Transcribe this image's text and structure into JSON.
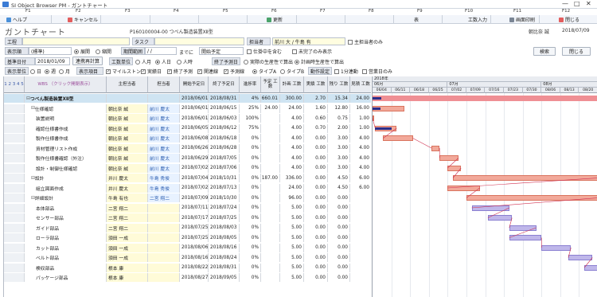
{
  "window": {
    "title": "SI Object Browser PM - ガントチャート",
    "controls": [
      "—",
      "□",
      "✕"
    ]
  },
  "fkeys": [
    "F1",
    "F2",
    "F3",
    "F4",
    "F5",
    "F6",
    "F7",
    "F8",
    "F9",
    "F10",
    "F11",
    "F12"
  ],
  "fbar": {
    "help": "ヘルプ",
    "cancel": "キャンセル",
    "update": "更新",
    "table": "表",
    "work_input": "工数入力",
    "print": "画面印刷",
    "close": "閉じる"
  },
  "heading": "ガントチャート",
  "project_id": "P160100004-00 つべん製造装置XⅡ型",
  "user_label": "朝比奈 誠",
  "date_right": "2018/07/09",
  "filters": {
    "process_label": "工程",
    "task_label": "タスク",
    "person_label": "担当者",
    "person_value": "朝比奈 誠",
    "person_value2": "前川 大 / 牛島 有",
    "only_main": "主担当者のみ",
    "display_label": "表示順",
    "display_value": "(標準)",
    "exp_label": "展開",
    "coll_label": "縮開",
    "period_label": "期間範囲",
    "period_value": "/ /",
    "period_to": "までに",
    "not_started": "開始予定",
    "in_progress": "仕掛中を含む",
    "not_done": "未完了のみ表示",
    "search": "検索",
    "close_btn": "閉じる",
    "date_label": "基準日付",
    "date_value": "2018/01/09",
    "recalc": "連携再計算",
    "unit_label": "工数単位",
    "unit_h": "人月",
    "unit_d": "人日",
    "unit_hr": "人時",
    "end_forecast": "終了予測日",
    "end_opt1": "実際の生産性で算出",
    "end_opt2": "計画時生産性で算出",
    "disp_unit": "表示単位",
    "disp_day": "日",
    "disp_week": "週",
    "disp_month": "月",
    "disp_items": "表示項目",
    "item_milestone": "マイルストン",
    "item_actual": "実績日",
    "item_end": "終了予測",
    "item_related": "関連線",
    "item_forecast": "予測線",
    "type_a": "タイプA",
    "type_b": "タイプB",
    "link_label": "動作設定",
    "item_1": "1分連動",
    "item_holiday": "営業日のみ"
  },
  "columns": {
    "c0": "1 2 3 4 5",
    "c1": "WBS （クリック開閉表示）",
    "c2": "主担当者",
    "c3": "担当者",
    "c4": "開始予定日",
    "c5": "終了予定日",
    "c6": "進捗率",
    "c7": "予定 工数",
    "c8": "計画 工数",
    "c9": "実績 工数",
    "c10": "残り 工数",
    "c11": "見積 工数"
  },
  "rows": [
    {
      "level": 0,
      "name": "つべん製造装置XⅡ型",
      "main": "",
      "pic": "",
      "start": "2018/06/01",
      "end": "2018/08/31",
      "pct": "4%",
      "plan": "660.01",
      "est": "300.00",
      "act": "2.70",
      "rem": "15.34",
      "quote": "24.00",
      "kind": "total"
    },
    {
      "level": 1,
      "name": "仕様確認",
      "main": "朝比奈 誠",
      "pic": "前川 慶太",
      "start": "2018/06/01",
      "end": "2018/06/15",
      "pct": "25%",
      "plan": "24.00",
      "est": "24.00",
      "act": "1.60",
      "rem": "12.80",
      "quote": "16.00",
      "kind": "group"
    },
    {
      "level": 2,
      "name": "装置説明",
      "main": "朝比奈 誠",
      "pic": "前川 慶太",
      "start": "2018/06/01",
      "end": "2018/06/03",
      "pct": "100%",
      "plan": "",
      "est": "4.00",
      "act": "0.60",
      "rem": "0.75",
      "quote": "1.00",
      "kind": "task"
    },
    {
      "level": 2,
      "name": "確認仕様書作成",
      "main": "朝比奈 誠",
      "pic": "前川 慶太",
      "start": "2018/06/05",
      "end": "2018/06/12",
      "pct": "75%",
      "plan": "",
      "est": "4.00",
      "act": "0.70",
      "rem": "2.00",
      "quote": "1.00",
      "kind": "task"
    },
    {
      "level": 2,
      "name": "製作仕様書作成",
      "main": "朝比奈 誠",
      "pic": "前川 慶太",
      "start": "2018/06/08",
      "end": "2018/06/18",
      "pct": "0%",
      "plan": "",
      "est": "4.00",
      "act": "0.00",
      "rem": "3.00",
      "quote": "4.00",
      "kind": "task"
    },
    {
      "level": 2,
      "name": "資材管理リスト作成",
      "main": "朝比奈 誠",
      "pic": "前川 慶太",
      "start": "2018/06/26",
      "end": "2018/06/28",
      "pct": "0%",
      "plan": "",
      "est": "4.00",
      "act": "0.00",
      "rem": "3.00",
      "quote": "4.00",
      "kind": "task"
    },
    {
      "level": 2,
      "name": "製作仕様書確認（外注）",
      "main": "朝比奈 誠",
      "pic": "前川 慶太",
      "start": "2018/06/29",
      "end": "2018/07/05",
      "pct": "0%",
      "plan": "",
      "est": "4.00",
      "act": "0.00",
      "rem": "3.00",
      "quote": "4.00",
      "kind": "task"
    },
    {
      "level": 2,
      "name": "設計・制御仕様確認",
      "main": "朝比奈 誠",
      "pic": "前川 慶太",
      "start": "2018/07/02",
      "end": "2018/07/06",
      "pct": "0%",
      "plan": "",
      "est": "4.00",
      "act": "0.00",
      "rem": "3.00",
      "quote": "4.00",
      "kind": "task"
    },
    {
      "level": 1,
      "name": "設計",
      "main": "井川 慶太",
      "pic": "牛島 秀俊",
      "start": "2018/07/04",
      "end": "2018/10/31",
      "pct": "0%",
      "plan": "187.00",
      "est": "336.00",
      "act": "0.00",
      "rem": "4.50",
      "quote": "6.00",
      "kind": "group"
    },
    {
      "level": 2,
      "name": "組立図面作成",
      "main": "井川 慶太",
      "pic": "牛島 秀俊",
      "start": "2018/07/02",
      "end": "2018/07/13",
      "pct": "0%",
      "plan": "",
      "est": "24.00",
      "act": "0.00",
      "rem": "4.50",
      "quote": "6.00",
      "kind": "task"
    },
    {
      "level": 1,
      "name": "詳細設計",
      "main": "牛島 有也",
      "pic": "二宮 翔二",
      "start": "2018/07/09",
      "end": "2018/10/30",
      "pct": "0%",
      "plan": "",
      "est": "96.00",
      "act": "0.00",
      "rem": "0.00",
      "quote": "",
      "kind": "group"
    },
    {
      "level": 2,
      "name": "本体部品",
      "main": "二宮 翔二",
      "pic": "",
      "start": "2018/07/11",
      "end": "2018/07/24",
      "pct": "0%",
      "plan": "",
      "est": "5.00",
      "act": "0.00",
      "rem": "0.00",
      "quote": "",
      "kind": "task2"
    },
    {
      "level": 2,
      "name": "センサー部品",
      "main": "二宮 翔二",
      "pic": "",
      "start": "2018/07/17",
      "end": "2018/07/25",
      "pct": "0%",
      "plan": "",
      "est": "5.00",
      "act": "0.00",
      "rem": "0.00",
      "quote": "",
      "kind": "task2"
    },
    {
      "level": 2,
      "name": "ガイド部品",
      "main": "二宮 翔二",
      "pic": "",
      "start": "2018/07/25",
      "end": "2018/08/03",
      "pct": "0%",
      "plan": "",
      "est": "5.00",
      "act": "0.00",
      "rem": "0.00",
      "quote": "",
      "kind": "task2"
    },
    {
      "level": 2,
      "name": "ローラ部品",
      "main": "須田 一成",
      "pic": "",
      "start": "2018/07/25",
      "end": "2018/08/05",
      "pct": "0%",
      "plan": "",
      "est": "5.00",
      "act": "0.00",
      "rem": "0.00",
      "quote": "",
      "kind": "task2"
    },
    {
      "level": 2,
      "name": "カット部品",
      "main": "須田 一成",
      "pic": "",
      "start": "2018/08/06",
      "end": "2018/08/16",
      "pct": "0%",
      "plan": "",
      "est": "5.00",
      "act": "0.00",
      "rem": "0.00",
      "quote": "",
      "kind": "task2"
    },
    {
      "level": 2,
      "name": "ベルト部品",
      "main": "須田 一成",
      "pic": "",
      "start": "2018/08/16",
      "end": "2018/08/24",
      "pct": "0%",
      "plan": "",
      "est": "5.00",
      "act": "0.00",
      "rem": "0.00",
      "quote": "",
      "kind": "task2"
    },
    {
      "level": 2,
      "name": "検収部品",
      "main": "根本 康",
      "pic": "",
      "start": "2018/08/22",
      "end": "2018/08/31",
      "pct": "0%",
      "plan": "",
      "est": "5.00",
      "act": "0.00",
      "rem": "0.00",
      "quote": "",
      "kind": "task2"
    },
    {
      "level": 2,
      "name": "パッケージ部品",
      "main": "根本 康",
      "pic": "",
      "start": "2018/08/27",
      "end": "2018/09/05",
      "pct": "0%",
      "plan": "",
      "est": "5.00",
      "act": "0.00",
      "rem": "0.00",
      "quote": "",
      "kind": "task2"
    }
  ],
  "gantt": {
    "year": "2018年",
    "months": [
      "06月",
      "07月",
      "08月"
    ],
    "weeks": [
      "06/04",
      "06/11",
      "06/18",
      "06/25",
      "07/02",
      "07/09",
      "07/16",
      "07/23",
      "07/30",
      "08/06",
      "08/13",
      "08/20"
    ],
    "days": [
      "06/04",
      "06/11",
      "06/18",
      "06/25",
      "07/02",
      "07/09",
      "07/16",
      "07/23",
      "07/30",
      "08/06",
      "08/13",
      "08/20"
    ],
    "colors": {
      "plan": "#f2a99a",
      "plan_border": "#d9735e",
      "actual": "#2b2e8a",
      "total": "#ef8f94",
      "blue": "#bfb7ea",
      "blue_border": "#8a7fd1",
      "link": "#d03050"
    }
  }
}
